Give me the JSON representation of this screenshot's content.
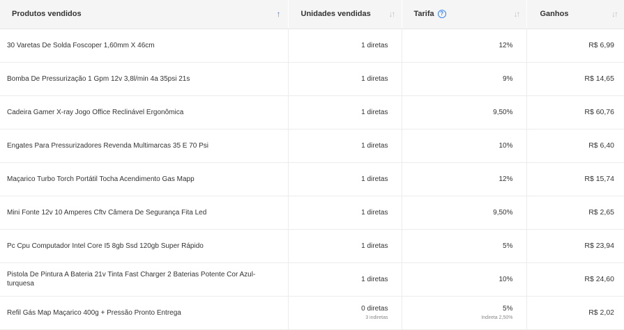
{
  "header": {
    "product": "Produtos vendidos",
    "units": "Unidades vendidas",
    "fee": "Tarifa",
    "gain": "Ganhos"
  },
  "icons": {
    "sort_active": "arrow-up-icon",
    "sort": "sort-arrows-icon",
    "help": "question-circle-icon"
  },
  "rows": [
    {
      "product": "30 Varetas De Solda Foscoper 1,60mm X 46cm",
      "units": "1 diretas",
      "units_sub": "",
      "fee": "12%",
      "fee_sub": "",
      "gain": "R$ 6,99"
    },
    {
      "product": "Bomba De Pressurização 1 Gpm 12v 3,8l/min 4a 35psi 21s",
      "units": "1 diretas",
      "units_sub": "",
      "fee": "9%",
      "fee_sub": "",
      "gain": "R$ 14,65"
    },
    {
      "product": "Cadeira Gamer X-ray Jogo Office Reclinável Ergonômica",
      "units": "1 diretas",
      "units_sub": "",
      "fee": "9,50%",
      "fee_sub": "",
      "gain": "R$ 60,76"
    },
    {
      "product": "Engates Para Pressurizadores Revenda Multimarcas 35 E 70 Psi",
      "units": "1 diretas",
      "units_sub": "",
      "fee": "10%",
      "fee_sub": "",
      "gain": "R$ 6,40"
    },
    {
      "product": "Maçarico Turbo Torch Portátil Tocha Acendimento Gas Mapp",
      "units": "1 diretas",
      "units_sub": "",
      "fee": "12%",
      "fee_sub": "",
      "gain": "R$ 15,74"
    },
    {
      "product": "Mini Fonte 12v 10 Amperes Cftv Câmera De Segurança Fita Led",
      "units": "1 diretas",
      "units_sub": "",
      "fee": "9,50%",
      "fee_sub": "",
      "gain": "R$ 2,65"
    },
    {
      "product": "Pc Cpu Computador Intel Core I5 8gb Ssd 120gb Super Rápido",
      "units": "1 diretas",
      "units_sub": "",
      "fee": "5%",
      "fee_sub": "",
      "gain": "R$ 23,94"
    },
    {
      "product": "Pistola De Pintura A Bateria 21v Tinta Fast Charger 2 Baterias Potente Cor Azul-turquesa",
      "units": "1 diretas",
      "units_sub": "",
      "fee": "10%",
      "fee_sub": "",
      "gain": "R$ 24,60"
    },
    {
      "product": "Refil Gás Map Maçarico 400g + Pressão Pronto Entrega",
      "units": "0 diretas",
      "units_sub": "3 indiretas",
      "fee": "5%",
      "fee_sub": "Indireta 2,50%",
      "gain": "R$ 2,02"
    }
  ]
}
